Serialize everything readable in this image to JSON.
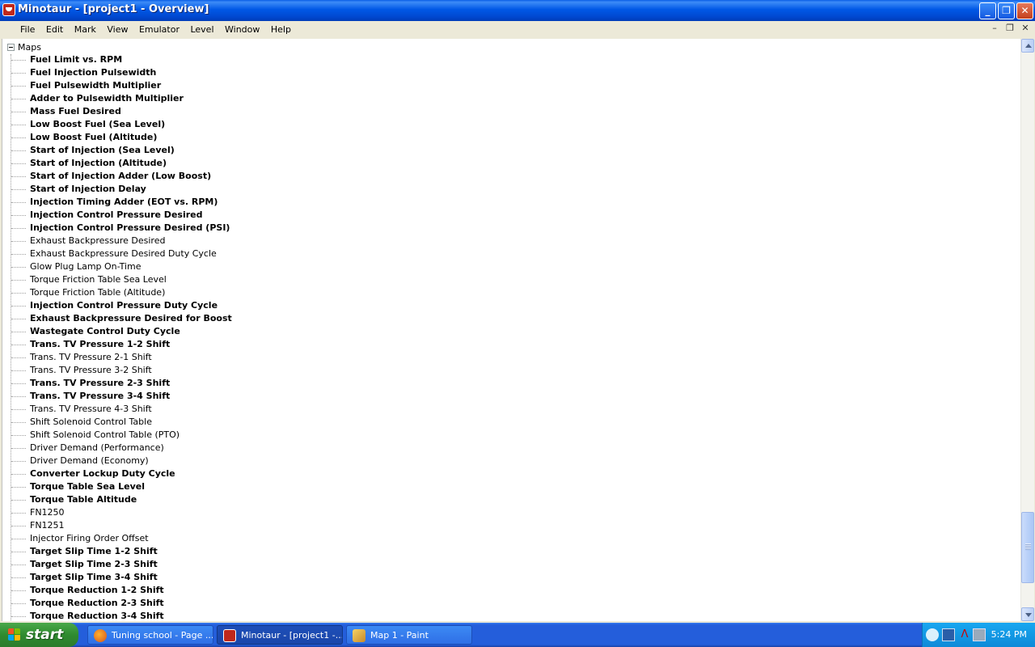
{
  "window": {
    "title": "Minotaur - [project1 - Overview]",
    "caption_buttons": [
      "minimize",
      "restore",
      "close"
    ]
  },
  "menubar": {
    "items": [
      "File",
      "Edit",
      "Mark",
      "View",
      "Emulator",
      "Level",
      "Window",
      "Help"
    ]
  },
  "tree": {
    "root_label": "Maps",
    "items": [
      {
        "label": "Fuel Limit vs. RPM",
        "bold": true
      },
      {
        "label": "Fuel Injection Pulsewidth",
        "bold": true
      },
      {
        "label": "Fuel Pulsewidth Multiplier",
        "bold": true
      },
      {
        "label": "Adder to Pulsewidth Multiplier",
        "bold": true
      },
      {
        "label": "Mass Fuel Desired",
        "bold": true
      },
      {
        "label": "Low Boost Fuel (Sea Level)",
        "bold": true
      },
      {
        "label": "Low Boost Fuel (Altitude)",
        "bold": true
      },
      {
        "label": "Start of Injection (Sea Level)",
        "bold": true
      },
      {
        "label": "Start of Injection (Altitude)",
        "bold": true
      },
      {
        "label": "Start of Injection Adder (Low Boost)",
        "bold": true
      },
      {
        "label": "Start of Injection Delay",
        "bold": true
      },
      {
        "label": "Injection Timing Adder (EOT vs. RPM)",
        "bold": true
      },
      {
        "label": "Injection Control Pressure Desired",
        "bold": true
      },
      {
        "label": "Injection Control Pressure Desired (PSI)",
        "bold": true
      },
      {
        "label": "Exhaust Backpressure Desired",
        "bold": false
      },
      {
        "label": "Exhaust Backpressure Desired Duty Cycle",
        "bold": false
      },
      {
        "label": "Glow Plug Lamp On-Time",
        "bold": false
      },
      {
        "label": "Torque Friction Table Sea Level",
        "bold": false
      },
      {
        "label": "Torque Friction Table (Altitude)",
        "bold": false
      },
      {
        "label": "Injection Control Pressure Duty Cycle",
        "bold": true
      },
      {
        "label": "Exhaust Backpressure Desired for Boost",
        "bold": true
      },
      {
        "label": "Wastegate Control Duty Cycle",
        "bold": true
      },
      {
        "label": "Trans. TV Pressure 1-2 Shift",
        "bold": true
      },
      {
        "label": "Trans. TV Pressure 2-1 Shift",
        "bold": false
      },
      {
        "label": "Trans. TV Pressure 3-2 Shift",
        "bold": false
      },
      {
        "label": "Trans. TV Pressure 2-3 Shift",
        "bold": true
      },
      {
        "label": "Trans. TV Pressure 3-4 Shift",
        "bold": true
      },
      {
        "label": "Trans. TV Pressure 4-3 Shift",
        "bold": false
      },
      {
        "label": "Shift Solenoid Control Table",
        "bold": false
      },
      {
        "label": "Shift Solenoid Control Table (PTO)",
        "bold": false
      },
      {
        "label": "Driver Demand (Performance)",
        "bold": false
      },
      {
        "label": "Driver Demand (Economy)",
        "bold": false
      },
      {
        "label": "Converter Lockup Duty Cycle",
        "bold": true
      },
      {
        "label": "Torque Table Sea Level",
        "bold": true
      },
      {
        "label": "Torque Table Altitude",
        "bold": true
      },
      {
        "label": "FN1250",
        "bold": false
      },
      {
        "label": "FN1251",
        "bold": false
      },
      {
        "label": "Injector Firing Order Offset",
        "bold": false
      },
      {
        "label": "Target Slip Time 1-2 Shift",
        "bold": true
      },
      {
        "label": "Target Slip Time 2-3 Shift",
        "bold": true
      },
      {
        "label": "Target Slip Time 3-4 Shift",
        "bold": true
      },
      {
        "label": "Torque Reduction 1-2 Shift",
        "bold": true
      },
      {
        "label": "Torque Reduction 2-3 Shift",
        "bold": true
      },
      {
        "label": "Torque Reduction 3-4 Shift",
        "bold": true
      }
    ]
  },
  "scrollbar": {
    "position": 0.95
  },
  "taskbar": {
    "start_label": "start",
    "tasks": [
      {
        "label": "Tuning school - Page ...",
        "icon": "firefox-icon",
        "active": false
      },
      {
        "label": "Minotaur - [project1 -...",
        "icon": "minotaur-icon",
        "active": true
      },
      {
        "label": "Map 1 - Paint",
        "icon": "paint-icon",
        "active": false
      }
    ],
    "clock": "5:24 PM"
  },
  "colors": {
    "titlebar": "#0058e6",
    "taskbar": "#245edb",
    "start_button": "#2f8b2f",
    "tray": "#0e8ad8"
  }
}
